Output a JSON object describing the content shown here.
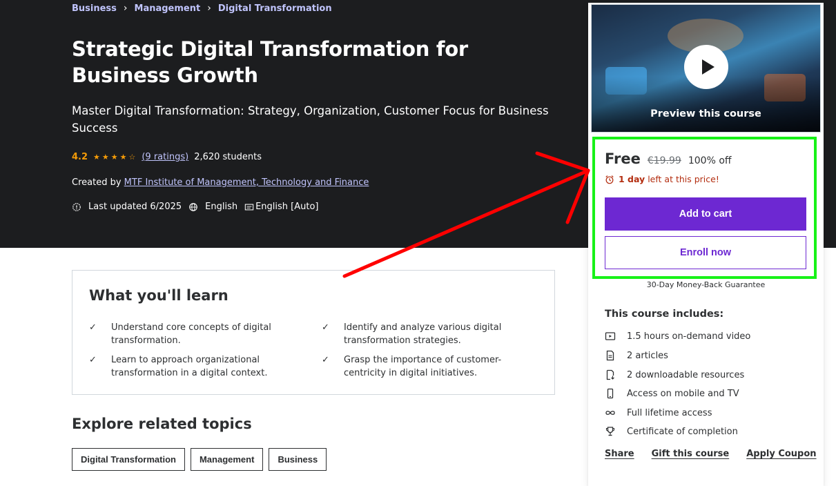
{
  "breadcrumb": [
    "Business",
    "Management",
    "Digital Transformation"
  ],
  "course": {
    "title": "Strategic Digital Transformation for Business Growth",
    "subtitle": "Master Digital Transformation: Strategy, Organization, Customer Focus for Business Success",
    "rating": "4.2",
    "stars": "★★★★☆",
    "ratings_count": "(9 ratings)",
    "students": "2,620 students",
    "created_by_label": "Created by",
    "instructor": "MTF Institute of Management, Technology and Finance",
    "last_updated": "Last updated 6/2025",
    "language": "English",
    "captions": "English [Auto]"
  },
  "learn": {
    "title": "What you'll learn",
    "items": [
      "Understand core concepts of digital transformation.",
      "Identify and analyze various digital transformation strategies.",
      "Learn to approach organizational transformation in a digital context.",
      "Grasp the importance of customer-centricity in digital initiatives."
    ]
  },
  "explore": {
    "title": "Explore related topics",
    "topics": [
      "Digital Transformation",
      "Management",
      "Business"
    ]
  },
  "sidebar": {
    "preview_label": "Preview this course",
    "price": "Free",
    "original_price": "€19.99",
    "discount": "100% off",
    "time_left_bold": "1 day",
    "time_left_rest": "left at this price!",
    "add_to_cart": "Add to cart",
    "enroll_now": "Enroll now",
    "guarantee": "30-Day Money-Back Guarantee",
    "includes_title": "This course includes:",
    "includes": [
      {
        "icon": "video-icon",
        "text": "1.5 hours on-demand video"
      },
      {
        "icon": "article-icon",
        "text": "2 articles"
      },
      {
        "icon": "download-icon",
        "text": "2 downloadable resources"
      },
      {
        "icon": "mobile-icon",
        "text": "Access on mobile and TV"
      },
      {
        "icon": "infinity-icon",
        "text": "Full lifetime access"
      },
      {
        "icon": "trophy-icon",
        "text": "Certificate of completion"
      }
    ],
    "share": "Share",
    "gift": "Gift this course",
    "coupon": "Apply Coupon"
  },
  "colors": {
    "hero_bg": "#1c1d1f",
    "accent_purple": "#6d28d2",
    "link_lavender": "#c0c4fc",
    "star_orange": "#f69c08",
    "highlight_green": "#18f218",
    "annotation_red": "#ff0000",
    "urgency_red": "#b32d0f"
  }
}
